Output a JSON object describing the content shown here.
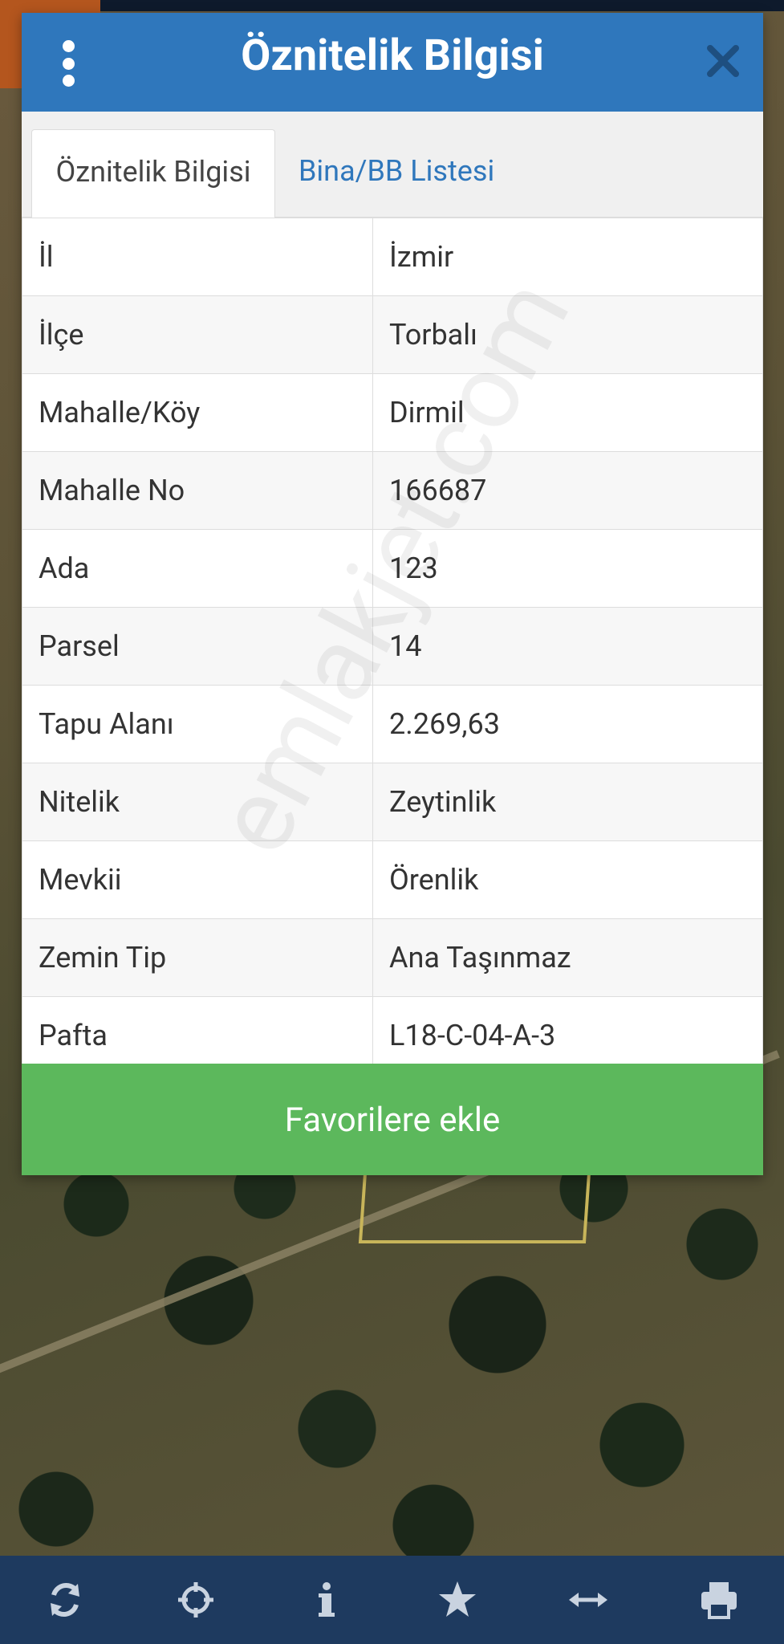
{
  "dialog": {
    "title": "Öznitelik Bilgisi"
  },
  "tabs": [
    {
      "label": "Öznitelik Bilgisi",
      "active": true
    },
    {
      "label": "Bina/BB Listesi",
      "active": false
    }
  ],
  "attributes": [
    {
      "key": "İl",
      "value": "İzmir"
    },
    {
      "key": "İlçe",
      "value": "Torbalı"
    },
    {
      "key": "Mahalle/Köy",
      "value": "Dirmil"
    },
    {
      "key": "Mahalle No",
      "value": "166687"
    },
    {
      "key": "Ada",
      "value": "123"
    },
    {
      "key": "Parsel",
      "value": "14"
    },
    {
      "key": "Tapu Alanı",
      "value": "2.269,63"
    },
    {
      "key": "Nitelik",
      "value": "Zeytinlik"
    },
    {
      "key": "Mevkii",
      "value": "Örenlik"
    },
    {
      "key": "Zemin Tip",
      "value": "Ana Taşınmaz"
    },
    {
      "key": "Pafta",
      "value": "L18-C-04-A-3"
    }
  ],
  "favorite_button": {
    "label": "Favorilere ekle"
  },
  "watermark": "emlakjet.com",
  "toolbar": {
    "icons": [
      "refresh-icon",
      "crosshair-icon",
      "info-icon",
      "star-icon",
      "arrows-horizontal-icon",
      "print-icon"
    ]
  },
  "colors": {
    "header": "#2f77bc",
    "tab_link": "#2f77bc",
    "favorite_button": "#5cb85c",
    "bottom_bar": "#1e3a5f"
  }
}
